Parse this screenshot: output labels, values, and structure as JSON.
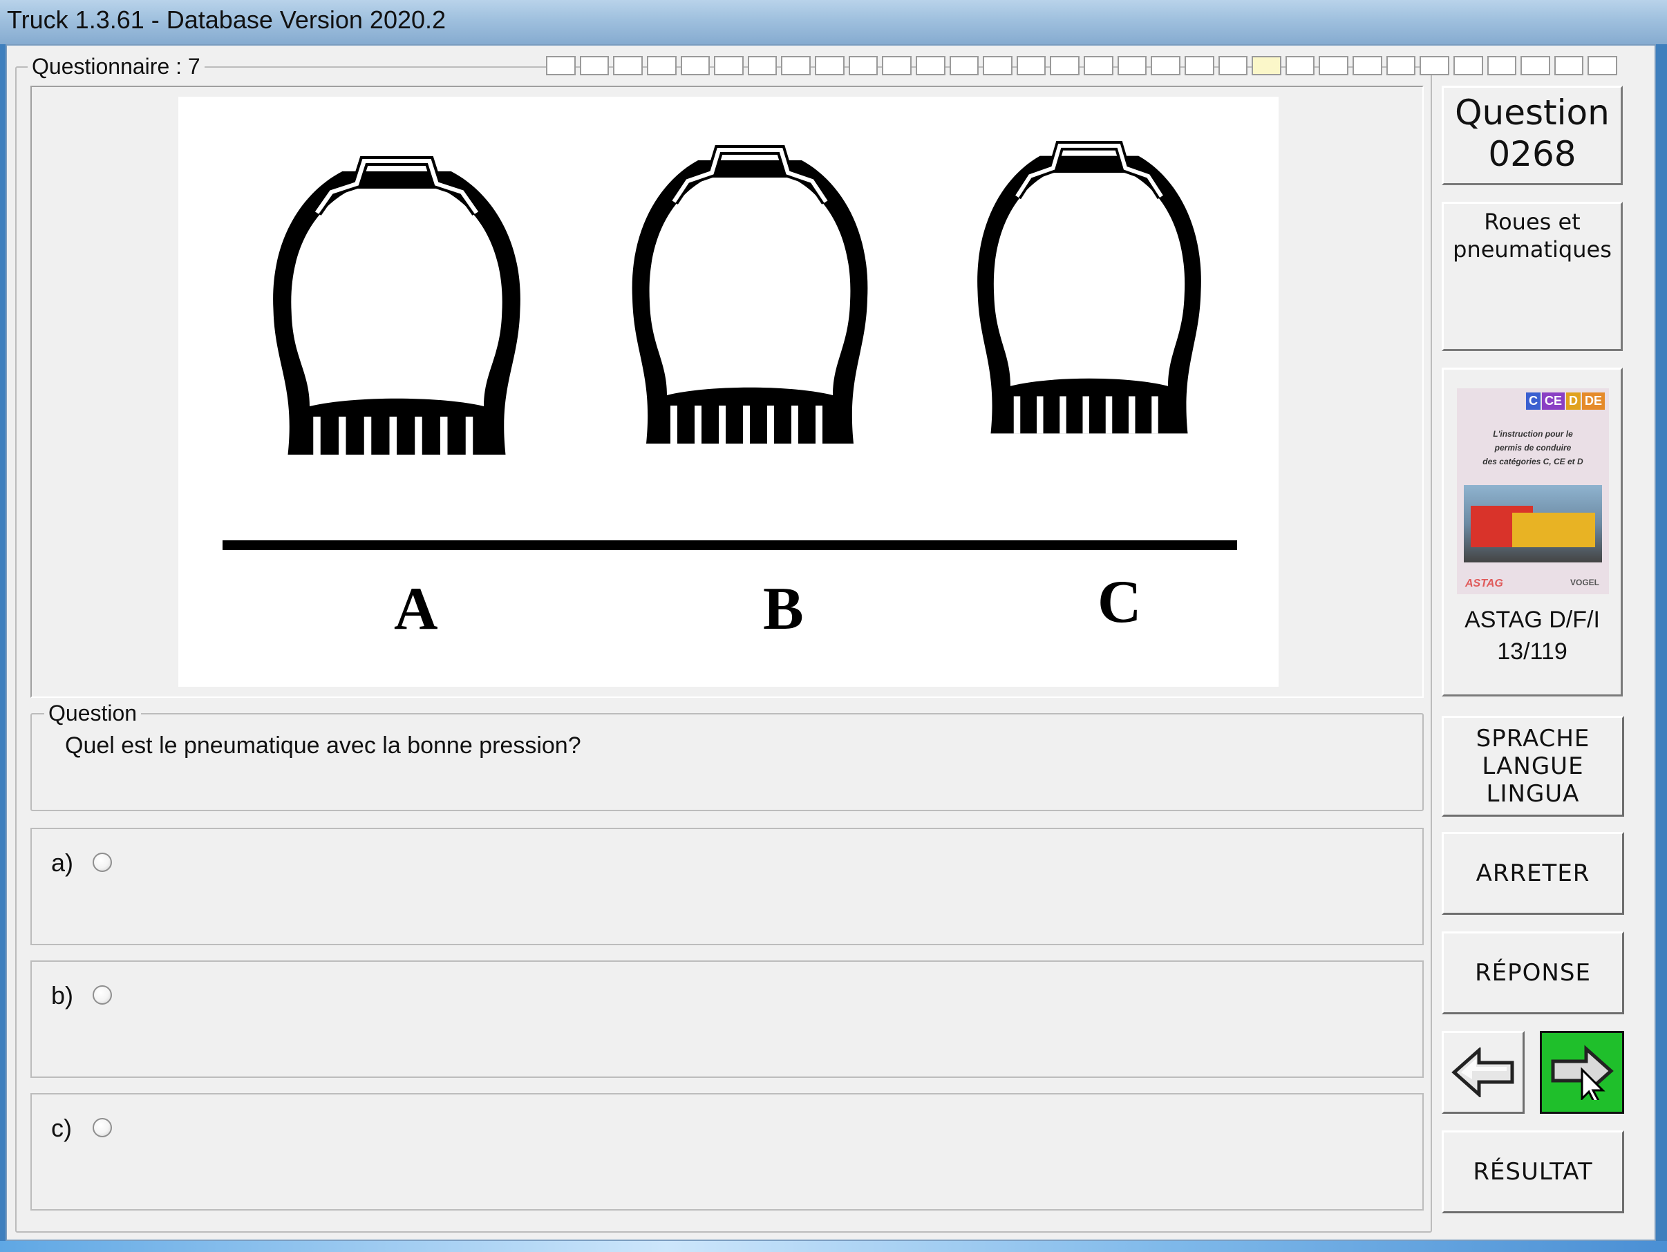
{
  "window": {
    "title": "Truck 1.3.61 - Database Version 2020.2"
  },
  "questionnaire": {
    "label": "Questionnaire : 7",
    "progress_total": 32,
    "progress_current_index": 21
  },
  "figure": {
    "labels": [
      "A",
      "B",
      "C"
    ]
  },
  "question": {
    "group_label": "Question",
    "text": "Quel est le pneumatique avec la bonne pression?"
  },
  "answers": [
    {
      "letter": "a)",
      "text": ""
    },
    {
      "letter": "b)",
      "text": ""
    },
    {
      "letter": "c)",
      "text": ""
    }
  ],
  "sidebar": {
    "question_title": "Question",
    "question_number": "0268",
    "category_line1": "Roues et",
    "category_line2": "pneumatiques",
    "book": {
      "badges": [
        "C",
        "CE",
        "D",
        "DE"
      ],
      "cover_text": [
        "L'instruction pour le",
        "permis de conduire",
        "des catégories C, CE et D"
      ],
      "cover_logo_left": "ASTAG",
      "cover_logo_right": "VOGEL",
      "source_line1": "ASTAG D/F/I",
      "source_line2": "13/119"
    },
    "language_button": [
      "SPRACHE",
      "LANGUE",
      "LINGUA"
    ],
    "stop_button": "ARRETER",
    "answer_button": "RÉPONSE",
    "result_button": "RÉSULTAT",
    "colors": {
      "next_button_bg": "#1fbf2b",
      "badge_c": "#3a5fd0",
      "badge_ce": "#8a3fc4",
      "badge_d": "#e0a21f",
      "badge_de": "#e58a2a"
    },
    "icons": {
      "prev": "arrow-left-icon",
      "next": "arrow-right-icon",
      "cursor": "mouse-pointer-icon"
    }
  }
}
